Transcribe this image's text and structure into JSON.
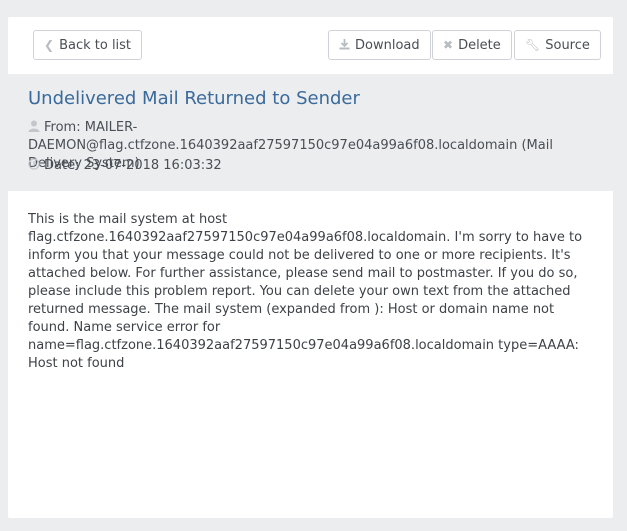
{
  "toolbar": {
    "back_label": "Back to list",
    "download_label": "Download",
    "delete_label": "Delete",
    "source_label": "Source"
  },
  "message": {
    "subject": "Undelivered Mail Returned to Sender",
    "from_label": "From:",
    "from_value": "MAILER-DAEMON@flag.ctfzone.1640392aaf27597150c97e04a99a6f08.localdomain (Mail Delivery System)",
    "date_label": "Date:",
    "date_value": "23-07-2018 16:03:32",
    "body": "This is the mail system at host flag.ctfzone.1640392aaf27597150c97e04a99a6f08.localdomain. I'm sorry to have to inform you that your message could not be delivered to one or more recipients. It's attached below. For further assistance, please send mail to postmaster. If you do so, please include this problem report. You can delete your own text from the attached returned message. The mail system (expanded from ): Host or domain name not found. Name service error for name=flag.ctfzone.1640392aaf27597150c97e04a99a6f08.localdomain type=AAAA: Host not found"
  },
  "icons": {
    "back": "chevron-left-icon",
    "download": "download-icon",
    "delete": "close-icon",
    "source": "wrench-icon",
    "from": "user-icon",
    "date": "clock-icon"
  },
  "colors": {
    "subject": "#3a6a9b",
    "header_bg": "#ebedef",
    "panel_bg": "#ffffff"
  }
}
